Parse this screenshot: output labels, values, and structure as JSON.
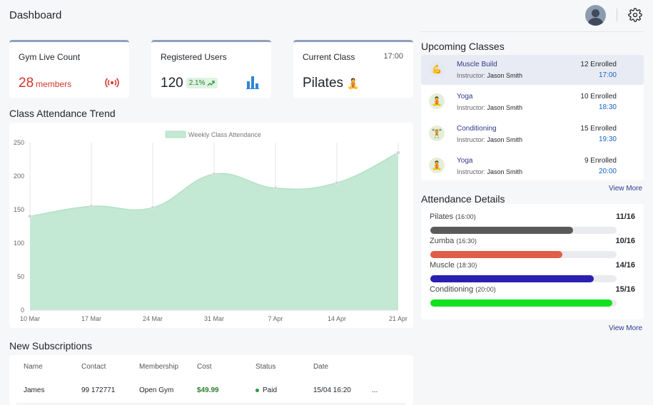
{
  "header": {
    "title": "Dashboard"
  },
  "stats": {
    "live": {
      "label": "Gym Live Count",
      "value": "28",
      "unit": "members"
    },
    "users": {
      "label": "Registered Users",
      "value": "120",
      "change": "2.1%"
    },
    "current": {
      "label": "Current Class",
      "time": "17:00",
      "name": "Pilates"
    }
  },
  "upcoming": {
    "title": "Upcoming Classes",
    "instructor_prefix": "Instructor:",
    "items": [
      {
        "name": "Muscle Build",
        "instructor": "Jason Smith",
        "enrolled": "12 Enrolled",
        "time": "17:00",
        "icon": "muscle-icon"
      },
      {
        "name": "Yoga",
        "instructor": "Jason Smith",
        "enrolled": "10 Enrolled",
        "time": "18:30",
        "icon": "yoga-icon"
      },
      {
        "name": "Conditioning",
        "instructor": "Jason Smith",
        "enrolled": "15 Enrolled",
        "time": "19:30",
        "icon": "conditioning-icon"
      },
      {
        "name": "Yoga",
        "instructor": "Jason Smith",
        "enrolled": "9 Enrolled",
        "time": "20:00",
        "icon": "yoga-icon"
      }
    ],
    "view_more": "View More"
  },
  "attendance_details": {
    "title": "Attendance Details",
    "items": [
      {
        "name": "Pilates",
        "time": "(16:00)",
        "value": "11/16",
        "fraction": 0.768,
        "color": "#5a5a5a"
      },
      {
        "name": "Zumba",
        "time": "(16:30)",
        "value": "10/16",
        "fraction": 0.71,
        "color": "#e05d4a"
      },
      {
        "name": "Muscle",
        "time": "(18:30)",
        "value": "14/16",
        "fraction": 0.877,
        "color": "#2a1fb0"
      },
      {
        "name": "Conditioning",
        "time": "(20:00)",
        "value": "15/16",
        "fraction": 0.977,
        "color": "#12e11e"
      }
    ],
    "view_more": "View More"
  },
  "trend": {
    "title": "Class Attendance Trend"
  },
  "chart_data": {
    "type": "area",
    "legend": "Weekly Class Attendance",
    "legend_position": "top",
    "categories": [
      "10 Mar",
      "17 Mar",
      "24 Mar",
      "31 Mar",
      "7 Apr",
      "14 Apr",
      "21 Apr"
    ],
    "series": [
      {
        "name": "Weekly Class Attendance",
        "values": [
          140,
          155,
          153,
          203,
          182,
          190,
          235
        ]
      }
    ],
    "ylim": [
      0,
      250
    ],
    "yticks": [
      "0",
      "50",
      "100",
      "150",
      "200",
      "250"
    ],
    "color": "#c3e8d3",
    "line_color": "#b5e1c6"
  },
  "subscriptions": {
    "title": "New Subscriptions",
    "columns": [
      "Name",
      "Contact",
      "Membership",
      "Cost",
      "Status",
      "Date"
    ],
    "rows": [
      {
        "name": "James",
        "contact": "99 172771",
        "membership": "Open Gym",
        "cost": "$49.99",
        "status": "Paid",
        "date": "15/04 16:20",
        "more": "..."
      }
    ]
  }
}
